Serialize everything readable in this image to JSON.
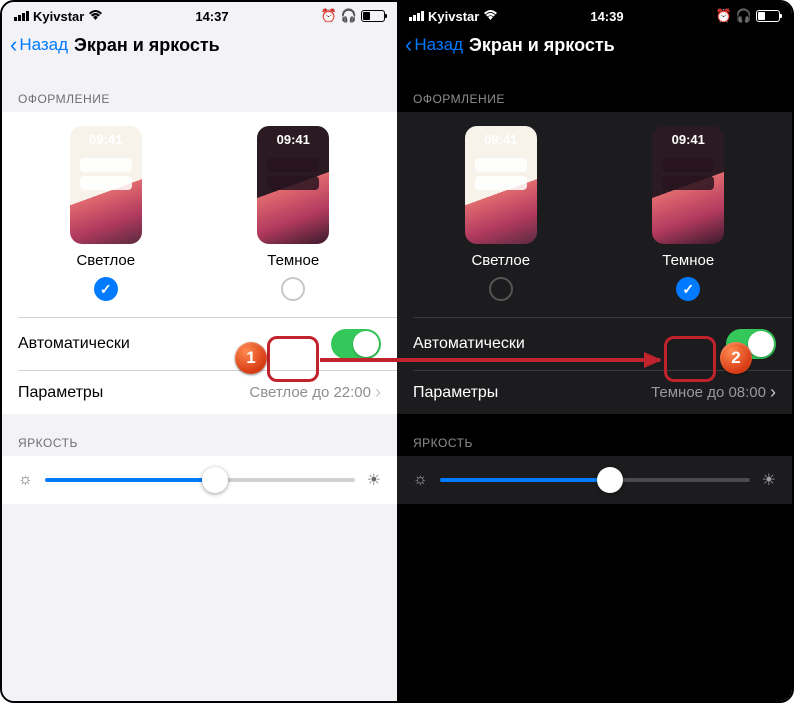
{
  "light": {
    "status": {
      "carrier": "Kyivstar",
      "time": "14:37"
    },
    "nav": {
      "back": "Назад",
      "title": "Экран и яркость"
    },
    "section_appearance": "ОФОРМЛЕНИЕ",
    "options": {
      "clock": "09:41",
      "light_label": "Светлое",
      "dark_label": "Темное",
      "selected": "light"
    },
    "auto_label": "Автоматически",
    "params_label": "Параметры",
    "params_value": "Светлое до 22:00",
    "section_brightness": "ЯРКОСТЬ"
  },
  "dark": {
    "status": {
      "carrier": "Kyivstar",
      "time": "14:39"
    },
    "nav": {
      "back": "Назад",
      "title": "Экран и яркость"
    },
    "section_appearance": "ОФОРМЛЕНИЕ",
    "options": {
      "clock": "09:41",
      "light_label": "Светлое",
      "dark_label": "Темное",
      "selected": "dark"
    },
    "auto_label": "Автоматически",
    "params_label": "Параметры",
    "params_value": "Темное до 08:00",
    "section_brightness": "ЯРКОСТЬ"
  },
  "annotations": {
    "step1": "1",
    "step2": "2"
  }
}
